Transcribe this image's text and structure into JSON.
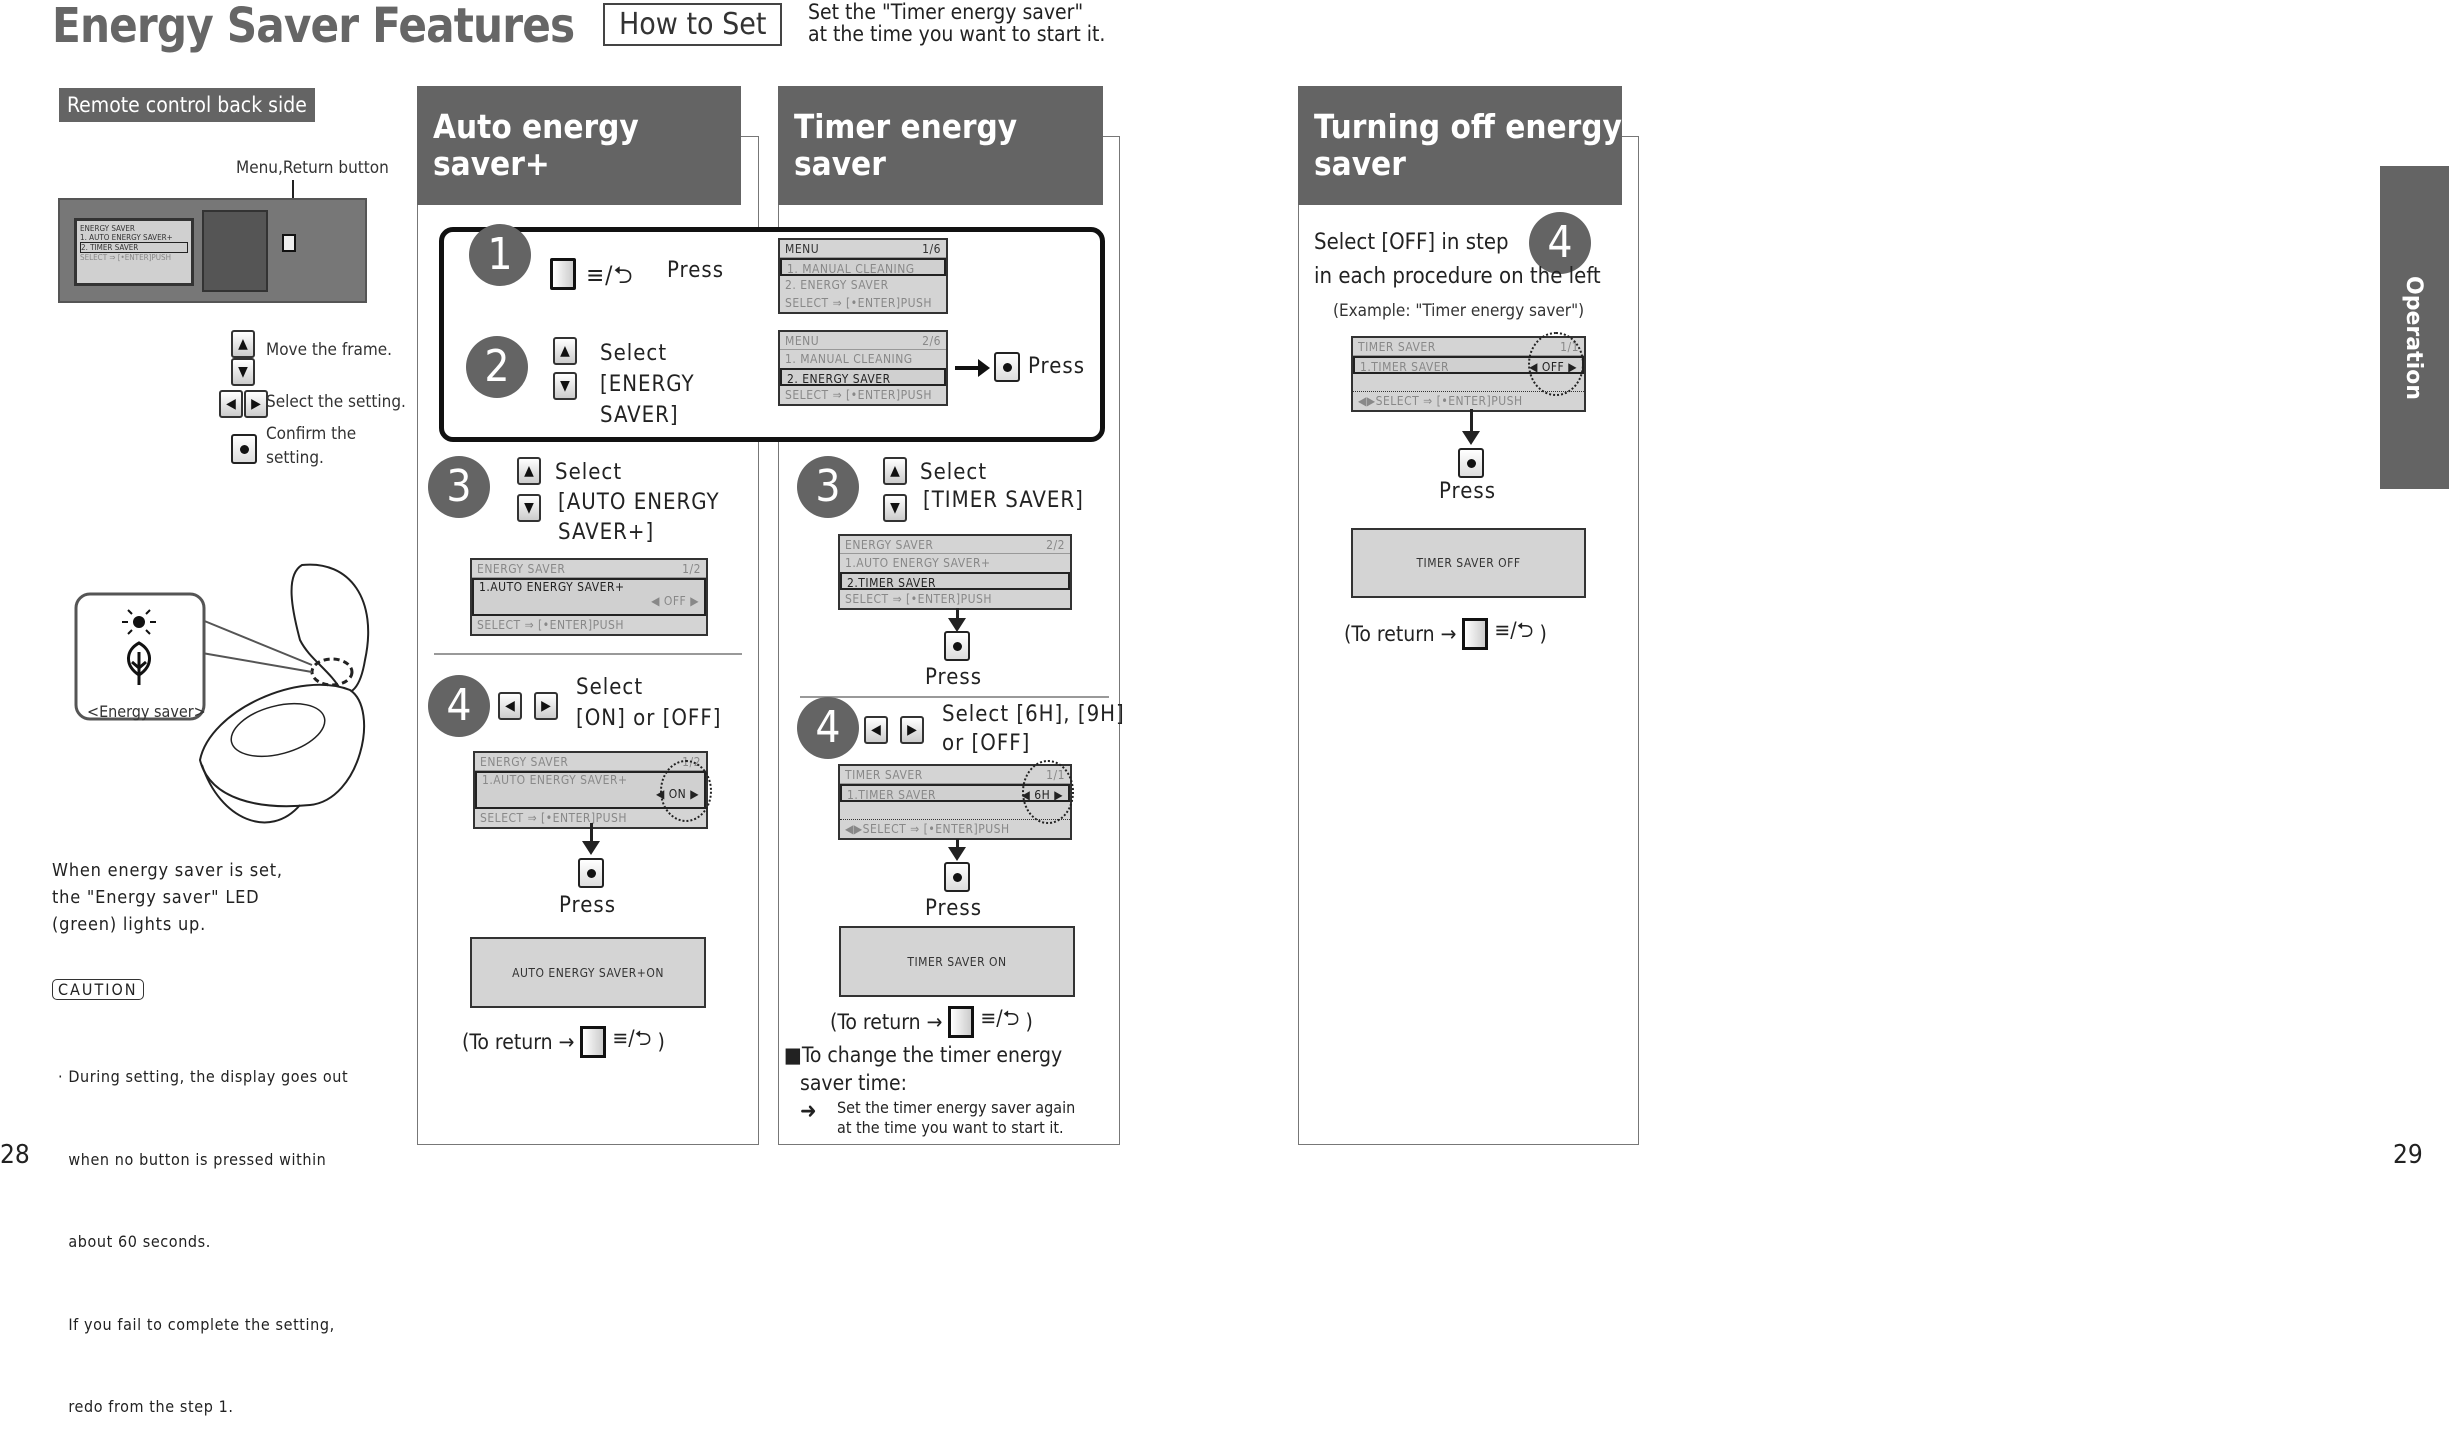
{
  "header": {
    "title": "Energy Saver Features",
    "how_to_set": "How to Set",
    "note_line1": "Set the \"Timer energy saver\"",
    "note_line2": "at the time you want to start it."
  },
  "left": {
    "label": "Remote control back side",
    "menu_return": "Menu,Return button",
    "remote_lcd": {
      "title": "ENERGY SAVER",
      "page": "1/2",
      "item1": "1. AUTO ENERGY SAVER+",
      "item2": "2. TIMER SAVER",
      "footer": "SELECT ⇒ [•ENTER]PUSH"
    },
    "move_frame": "Move the frame.",
    "select_setting": "Select the setting.",
    "confirm1": "Confirm the",
    "confirm2": "setting.",
    "energy_saver": "<Energy saver>",
    "led_lines": [
      "When energy saver is set,",
      "the \"Energy saver\" LED",
      "(green) lights up."
    ],
    "caution": "CAUTION",
    "caution_lines": [
      "· During setting, the display goes out",
      "  when no button is pressed within",
      "  about 60 seconds.",
      "  If you fail to complete the setting,",
      "  redo from the step 1."
    ]
  },
  "common": {
    "press": "Press",
    "menu_icon": "≡/⮌",
    "to_return": "(To return →",
    "close_paren": ")",
    "select": "Select",
    "footer": "SELECT ⇒ [•ENTER]PUSH"
  },
  "steps12": {
    "n1": "1",
    "n2": "2",
    "s2_line1": "Select",
    "s2_line2": "[ENERGY",
    "s2_line3": "SAVER]",
    "lcd1": {
      "title": "MENU",
      "page": "1/6",
      "item1": "1. MANUAL CLEANING",
      "item2": "2. ENERGY SAVER"
    },
    "lcd2": {
      "title": "MENU",
      "page": "2/6",
      "item1": "1. MANUAL CLEANING",
      "item2": "2. ENERGY SAVER"
    }
  },
  "auto": {
    "title_line1": "Auto energy",
    "title_line2": "saver+",
    "n3": "3",
    "s3_line2": "[AUTO ENERGY",
    "s3_line3": "SAVER+]",
    "lcd3": {
      "title": "ENERGY SAVER",
      "page": "1/2",
      "item": "1.AUTO ENERGY SAVER+",
      "value": "OFF"
    },
    "n4": "4",
    "s4_line2": "[ON] or [OFF]",
    "lcd4": {
      "title": "ENERGY SAVER",
      "page": "1/2",
      "item": "1.AUTO ENERGY SAVER+",
      "value": "ON"
    },
    "result": "AUTO ENERGY SAVER+ON"
  },
  "timer": {
    "title_line1": "Timer energy",
    "title_line2": "saver",
    "n3": "3",
    "s3_line2": "[TIMER SAVER]",
    "lcd3": {
      "title": "ENERGY SAVER",
      "page": "2/2",
      "item1": "1.AUTO ENERGY SAVER+",
      "item2": "2.TIMER SAVER"
    },
    "n4": "4",
    "s4_line1": "Select [6H], [9H]",
    "s4_line2": "or [OFF]",
    "lcd4": {
      "title": "TIMER SAVER",
      "page": "1/1",
      "item": "1.TIMER SAVER",
      "value": "6H"
    },
    "result": "TIMER SAVER ON",
    "change_line1": "■To change the timer energy",
    "change_line2": "saver time:",
    "change_line3": "Set the timer energy saver again",
    "change_line4": "at the time you want to start it."
  },
  "off": {
    "title_line1": "Turning off energy",
    "title_line2": "saver",
    "line1": "Select [OFF] in step",
    "n": "4",
    "line2": "in each procedure on the left",
    "example": "(Example: \"Timer energy saver\")",
    "lcd": {
      "title": "TIMER SAVER",
      "page": "1/1",
      "item": "1.TIMER SAVER",
      "value": "OFF"
    },
    "result": "TIMER SAVER OFF"
  },
  "side_tab": "Operation",
  "page_left": "28",
  "page_right": "29"
}
